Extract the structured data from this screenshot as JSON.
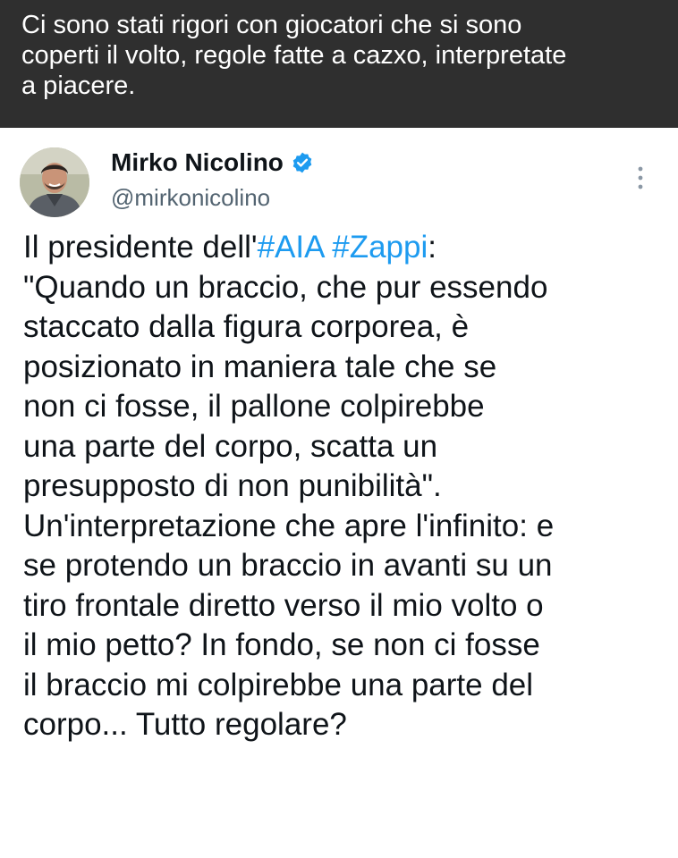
{
  "caption": {
    "lines": [
      "Ci sono stati rigori con giocatori che si sono",
      "coperti il volto, regole fatte a cazxo, interpretate",
      "a piacere."
    ]
  },
  "tweet": {
    "author_name": "Mirko Nicolino",
    "handle": "@mirkonicolino",
    "verified_icon": "verified-badge-icon",
    "more_icon": "more-vertical-icon",
    "accent_color": "#1d9bf0",
    "body": {
      "line1_prefix": "Il presidente dell'",
      "hashtag1": "#AIA",
      "hashtag_space": " ",
      "hashtag2": "#Zappi",
      "line1_suffix": ":",
      "lines": [
        "\"Quando un braccio, che pur essendo",
        "staccato dalla figura corporea, è",
        "posizionato in maniera tale che se",
        "non ci fosse, il pallone colpirebbe",
        "una parte del corpo, scatta un",
        "presupposto di non punibilità\".",
        "Un'interpretazione che apre l'infinito: e",
        "se protendo un braccio in avanti su un",
        "tiro frontale diretto verso il mio volto o",
        "il mio petto? In fondo, se non ci fosse",
        "il braccio mi colpirebbe una parte del",
        "corpo... Tutto regolare?"
      ]
    }
  }
}
